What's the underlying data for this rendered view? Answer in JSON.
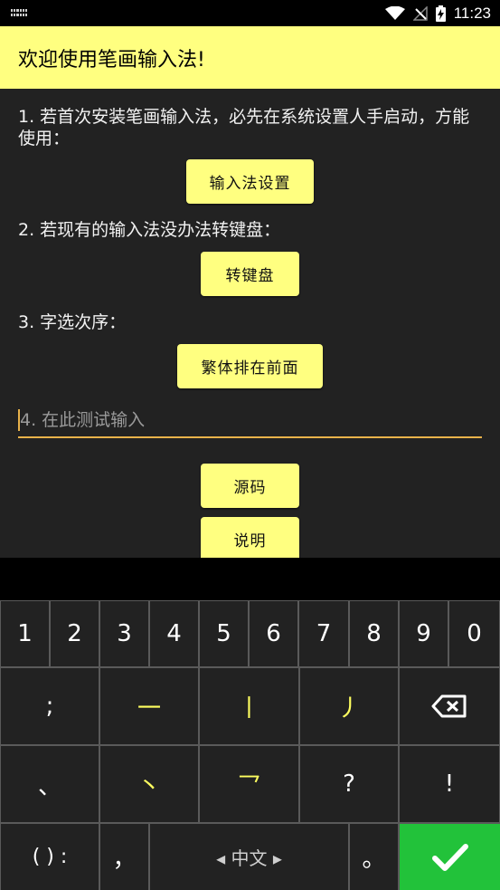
{
  "status_bar": {
    "time": "11:23"
  },
  "title": "欢迎使用笔画输入法!",
  "steps": {
    "step1": "1. 若首次安装笔画输入法，必先在系统设置人手启动，方能使用：",
    "step1_button": "输入法设置",
    "step2": "2. 若现有的输入法没办法转键盘：",
    "step2_button": "转键盘",
    "step3": "3. 字选次序：",
    "step3_button": "繁体排在前面",
    "test_input_placeholder": "4. 在此测试输入",
    "source_button": "源码",
    "help_button": "说明"
  },
  "keyboard": {
    "numbers": [
      "1",
      "2",
      "3",
      "4",
      "5",
      "6",
      "7",
      "8",
      "9",
      "0"
    ],
    "row2": {
      "semicolon": ";",
      "heng": "一",
      "shu": "丨",
      "pie": "丿"
    },
    "row3": {
      "dun": "、",
      "dian": "丶",
      "zhe": "乛",
      "question": "?",
      "exclaim": "!"
    },
    "row4": {
      "punct": "( ) :",
      "comma": "，",
      "space": "◂ 中文 ▸",
      "period": "。"
    }
  },
  "colors": {
    "accent": "#ffff80",
    "enter": "#22c23a",
    "underline": "#e8b24a"
  }
}
